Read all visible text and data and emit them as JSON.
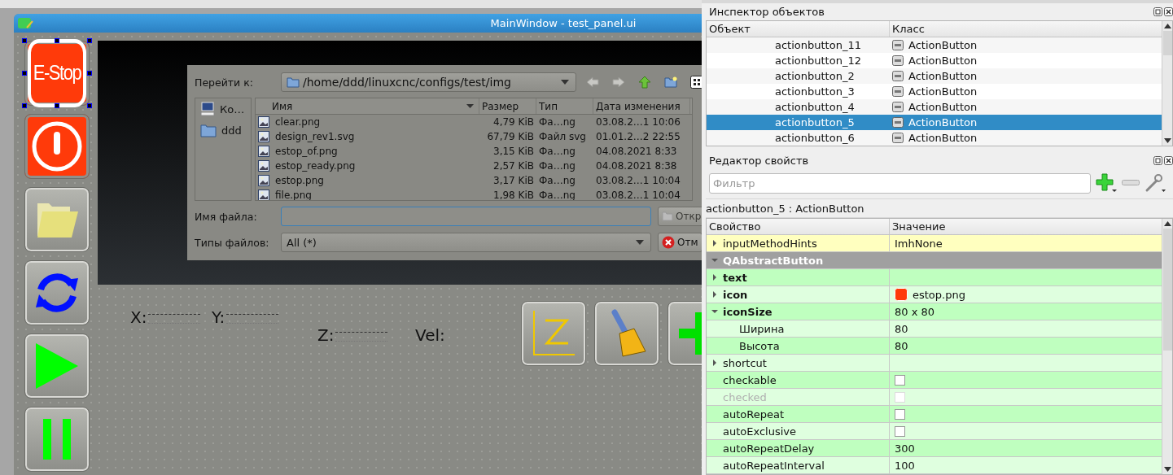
{
  "designer": {
    "window_title": "MainWindow - test_panel.ui",
    "side_buttons": [
      {
        "kind": "estop",
        "label": "E-Stop",
        "selected": true
      },
      {
        "kind": "power",
        "selected": false
      },
      {
        "kind": "folder",
        "selected": false
      },
      {
        "kind": "refresh",
        "selected": false
      },
      {
        "kind": "play",
        "selected": false
      },
      {
        "kind": "pause",
        "selected": false
      }
    ],
    "file_dialog": {
      "look_in_label": "Перейти к:",
      "path": "/home/ddd/linuxcnc/configs/test/img",
      "places": [
        {
          "kind": "computer",
          "label": "Ко…"
        },
        {
          "kind": "folder",
          "label": "ddd"
        }
      ],
      "columns": [
        "Имя",
        "Размер",
        "Тип",
        "Дата изменения"
      ],
      "files": [
        {
          "name": "clear.png",
          "size": "4,79 KiB",
          "type": "Фа…ng",
          "modified": "03.08.2…1 10:06"
        },
        {
          "name": "design_rev1.svg",
          "size": "67,79 KiB",
          "type": "Файл svg",
          "modified": "01.01.2…2 22:55"
        },
        {
          "name": "estop_of.png",
          "size": "3,15 KiB",
          "type": "Фа…ng",
          "modified": "04.08.2021 8:33"
        },
        {
          "name": "estop_ready.png",
          "size": "2,57 KiB",
          "type": "Фа…ng",
          "modified": "04.08.2021 8:38"
        },
        {
          "name": "estop.png",
          "size": "3,17 KiB",
          "type": "Фа…ng",
          "modified": "03.08.2…1 10:04"
        },
        {
          "name": "file.png",
          "size": "1,98 KiB",
          "type": "Фа…ng",
          "modified": "03.08.2…1 10:04"
        }
      ],
      "filename_label": "Имя файла:",
      "open_button": "Откр",
      "filetype_label": "Типы файлов:",
      "filetype": "All (*)",
      "cancel_button": "Отм"
    },
    "readouts": [
      {
        "kind": "field",
        "label": "X:"
      },
      {
        "kind": "field",
        "label": "Y:"
      },
      {
        "kind": "field",
        "label": "Z:"
      },
      {
        "kind": "plain",
        "label": "Vel:"
      }
    ],
    "tool_buttons": [
      {
        "kind": "zero"
      },
      {
        "kind": "brush"
      },
      {
        "kind": "plus"
      }
    ]
  },
  "object_inspector": {
    "title": "Инспектор объектов",
    "columns": [
      "Объект",
      "Класс"
    ],
    "rows": [
      {
        "object": "actionbutton_11",
        "class": "ActionButton",
        "selected": false
      },
      {
        "object": "actionbutton_12",
        "class": "ActionButton",
        "selected": false
      },
      {
        "object": "actionbutton_2",
        "class": "ActionButton",
        "selected": false
      },
      {
        "object": "actionbutton_3",
        "class": "ActionButton",
        "selected": false
      },
      {
        "object": "actionbutton_4",
        "class": "ActionButton",
        "selected": false
      },
      {
        "object": "actionbutton_5",
        "class": "ActionButton",
        "selected": true
      },
      {
        "object": "actionbutton_6",
        "class": "ActionButton",
        "selected": false
      }
    ]
  },
  "property_editor": {
    "title": "Редактор свойств",
    "filter_placeholder": "Фильтр",
    "object_label": "actionbutton_5 : ActionButton",
    "columns": [
      "Свойство",
      "Значение"
    ],
    "rows": [
      {
        "kind": "text",
        "name": "inputMethodHints",
        "value": "ImhNone",
        "expanded": false,
        "modified": false,
        "color": "#ffffbf"
      },
      {
        "kind": "section",
        "name": "QAbstractButton",
        "expanded": true
      },
      {
        "kind": "text",
        "name": "text",
        "expanded": false,
        "modified": true,
        "color": "#bfffbf"
      },
      {
        "kind": "icon",
        "name": "icon",
        "value": "estop.png",
        "expanded": false,
        "modified": true,
        "color": "#dfffdf"
      },
      {
        "kind": "text",
        "name": "iconSize",
        "value": "80 x 80",
        "expanded": true,
        "modified": true,
        "color": "#bfffbf",
        "children": [
          {
            "kind": "text",
            "name": "Ширина",
            "value": "80",
            "modified": false,
            "color": "#dfffdf"
          },
          {
            "kind": "text",
            "name": "Высота",
            "value": "80",
            "modified": false,
            "color": "#bfffbf"
          }
        ]
      },
      {
        "kind": "text",
        "name": "shortcut",
        "expanded": false,
        "modified": false,
        "color": "#dfffdf"
      },
      {
        "kind": "checkbox",
        "name": "checkable",
        "checked": false,
        "disabled": false,
        "modified": false,
        "color": "#bfffbf"
      },
      {
        "kind": "checkbox",
        "name": "checked",
        "checked": false,
        "disabled": true,
        "modified": false,
        "color": "#dfffdf"
      },
      {
        "kind": "checkbox",
        "name": "autoRepeat",
        "checked": false,
        "disabled": false,
        "modified": false,
        "color": "#bfffbf"
      },
      {
        "kind": "checkbox",
        "name": "autoExclusive",
        "checked": false,
        "disabled": false,
        "modified": false,
        "color": "#dfffdf"
      },
      {
        "kind": "text",
        "name": "autoRepeatDelay",
        "value": "300",
        "modified": false,
        "color": "#bfffbf"
      },
      {
        "kind": "text",
        "name": "autoRepeatInterval",
        "value": "100",
        "modified": false,
        "color": "#dfffdf"
      }
    ]
  }
}
